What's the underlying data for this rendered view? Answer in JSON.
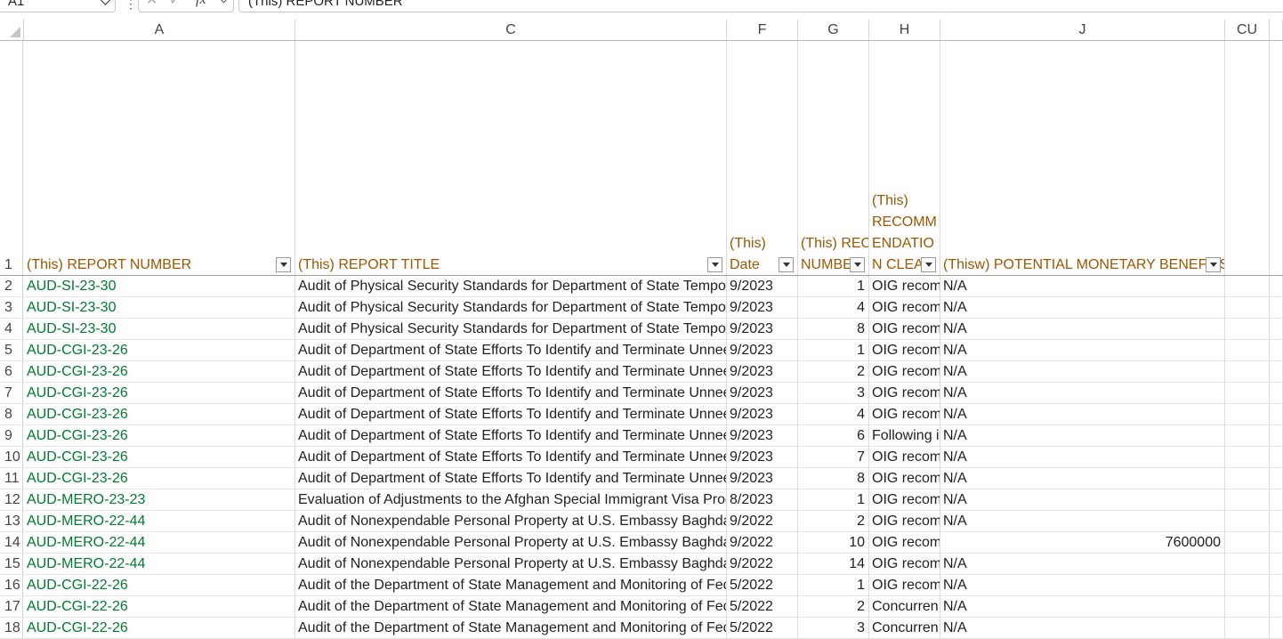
{
  "formula_bar": {
    "name_box": "A1",
    "formula": "(This) REPORT NUMBER"
  },
  "columns": [
    "A",
    "C",
    "F",
    "G",
    "H",
    "J",
    "CU"
  ],
  "header_row": {
    "row_number": "1",
    "A": [
      "(This) REPORT NUMBER"
    ],
    "C": [
      "(This) REPORT TITLE"
    ],
    "F": [
      "(This)",
      "Date"
    ],
    "G": [
      "(This) REC",
      "NUMBE"
    ],
    "H": [
      "(This)",
      "RECOMM",
      "ENDATIO",
      "N CLEA"
    ],
    "J": [
      "(Thisw) POTENTIAL MONETARY BENEFITS"
    ]
  },
  "rows": [
    {
      "n": "2",
      "A": "AUD-SI-23-30",
      "C": "Audit of Physical Security Standards for Department of State Tempor",
      "F": "9/2023",
      "G": "1",
      "H": "OIG recom",
      "J": "N/A"
    },
    {
      "n": "3",
      "A": "AUD-SI-23-30",
      "C": "Audit of Physical Security Standards for Department of State Tempor",
      "F": "9/2023",
      "G": "4",
      "H": "OIG recom",
      "J": "N/A"
    },
    {
      "n": "4",
      "A": "AUD-SI-23-30",
      "C": "Audit of Physical Security Standards for Department of State Tempor",
      "F": "9/2023",
      "G": "8",
      "H": "OIG recom",
      "J": "N/A"
    },
    {
      "n": "5",
      "A": "AUD-CGI-23-26",
      "C": "Audit of Department of State Efforts To Identify and Terminate Unnee",
      "F": "9/2023",
      "G": "1",
      "H": "OIG recom",
      "J": "N/A"
    },
    {
      "n": "6",
      "A": "AUD-CGI-23-26",
      "C": "Audit of Department of State Efforts To Identify and Terminate Unnee",
      "F": "9/2023",
      "G": "2",
      "H": "OIG recom",
      "J": "N/A"
    },
    {
      "n": "7",
      "A": "AUD-CGI-23-26",
      "C": "Audit of Department of State Efforts To Identify and Terminate Unnee",
      "F": "9/2023",
      "G": "3",
      "H": "OIG recom",
      "J": "N/A"
    },
    {
      "n": "8",
      "A": "AUD-CGI-23-26",
      "C": "Audit of Department of State Efforts To Identify and Terminate Unnee",
      "F": "9/2023",
      "G": "4",
      "H": "OIG recom",
      "J": "N/A"
    },
    {
      "n": "9",
      "A": "AUD-CGI-23-26",
      "C": "Audit of Department of State Efforts To Identify and Terminate Unnee",
      "F": "9/2023",
      "G": "6",
      "H": "Following i",
      "J": "N/A"
    },
    {
      "n": "10",
      "A": "AUD-CGI-23-26",
      "C": "Audit of Department of State Efforts To Identify and Terminate Unnee",
      "F": "9/2023",
      "G": "7",
      "H": "OIG recom",
      "J": "N/A"
    },
    {
      "n": "11",
      "A": "AUD-CGI-23-26",
      "C": "Audit of Department of State Efforts To Identify and Terminate Unnee",
      "F": "9/2023",
      "G": "8",
      "H": "OIG recom",
      "J": "N/A"
    },
    {
      "n": "12",
      "A": "AUD-MERO-23-23",
      "C": "Evaluation of Adjustments to the Afghan Special Immigrant Visa Prog",
      "F": "8/2023",
      "G": "1",
      "H": "OIG recom",
      "J": "N/A"
    },
    {
      "n": "13",
      "A": "AUD-MERO-22-44",
      "C": "Audit of Nonexpendable Personal Property at U.S. Embassy Baghdac",
      "F": "9/2022",
      "G": "2",
      "H": "OIG recom",
      "J": "N/A"
    },
    {
      "n": "14",
      "A": "AUD-MERO-22-44",
      "C": "Audit of Nonexpendable Personal Property at U.S. Embassy Baghdac",
      "F": "9/2022",
      "G": "10",
      "H": "OIG recom",
      "J": "7600000",
      "J_num": true
    },
    {
      "n": "15",
      "A": "AUD-MERO-22-44",
      "C": "Audit of Nonexpendable Personal Property at U.S. Embassy Baghdac",
      "F": "9/2022",
      "G": "14",
      "H": "OIG recom",
      "J": "N/A"
    },
    {
      "n": "16",
      "A": "AUD-CGI-22-26",
      "C": "Audit of the Department of State Management and Monitoring of Fede",
      "F": "5/2022",
      "G": "1",
      "H": "OIG recom",
      "J": "N/A"
    },
    {
      "n": "17",
      "A": "AUD-CGI-22-26",
      "C": "Audit of the Department of State Management and Monitoring of Fede",
      "F": "5/2022",
      "G": "2",
      "H": "Concurren",
      "J": "N/A"
    },
    {
      "n": "18",
      "A": "AUD-CGI-22-26",
      "C": "Audit of the Department of State Management and Monitoring of Fede",
      "F": "5/2022",
      "G": "3",
      "H": "Concurren",
      "J": "N/A"
    }
  ]
}
